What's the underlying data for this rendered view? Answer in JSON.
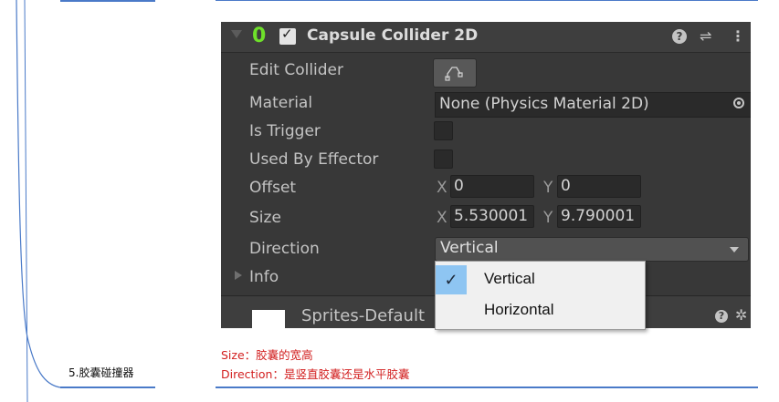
{
  "doc": {
    "left_label": "5.胶囊碰撞器",
    "note_size": "Size：胶囊的宽高",
    "note_direction": "Direction：是竖直胶囊还是水平胶囊"
  },
  "component": {
    "title": "Capsule Collider 2D",
    "enabled": true,
    "icons": [
      "collider-2d-icon",
      "help-icon",
      "preset-icon",
      "menu-icon"
    ]
  },
  "fields": {
    "edit_collider_label": "Edit Collider",
    "material_label": "Material",
    "material_value": "None (Physics Material 2D)",
    "is_trigger_label": "Is Trigger",
    "is_trigger": false,
    "used_by_effector_label": "Used By Effector",
    "used_by_effector": false,
    "offset_label": "Offset",
    "offset_x_axis": "X",
    "offset_x": "0",
    "offset_y_axis": "Y",
    "offset_y": "0",
    "size_label": "Size",
    "size_x_axis": "X",
    "size_x": "5.530001",
    "size_y_axis": "Y",
    "size_y": "9.790001",
    "direction_label": "Direction",
    "direction_value": "Vertical",
    "info_label": "Info"
  },
  "material_section": {
    "name": "Sprites-Default"
  },
  "direction_popup": {
    "options": [
      "Vertical",
      "Horizontal"
    ],
    "selected": "Vertical"
  },
  "colors": {
    "panel_bg": "#383838",
    "header_bg": "#3e3e3e",
    "accent_green": "#6ee02a",
    "note_red": "#d21e1e",
    "selection_blue": "#8ec5f2"
  }
}
